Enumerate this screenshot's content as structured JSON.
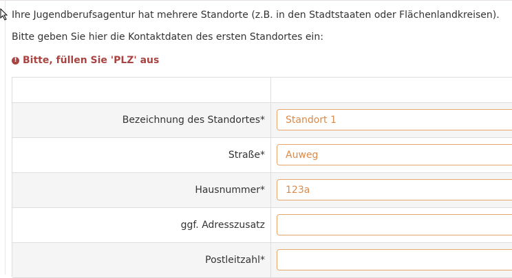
{
  "intro": {
    "line1": "Ihre Jugendberufsagentur hat mehrere Standorte (z.B. in den Stadtstaaten oder Flächenlandkreisen).",
    "line2": "Bitte geben Sie hier die Kontaktdaten des ersten Standortes ein:"
  },
  "error": {
    "message": "Bitte, füllen Sie 'PLZ' aus"
  },
  "form": {
    "fields": [
      {
        "label": "Bezeichnung des Standortes*",
        "value": "Standort 1"
      },
      {
        "label": "Straße*",
        "value": "Auweg"
      },
      {
        "label": "Hausnummer*",
        "value": "123a"
      },
      {
        "label": "ggf. Adresszusatz",
        "value": ""
      },
      {
        "label": "Postleitzahl*",
        "value": ""
      }
    ]
  },
  "colors": {
    "error": "#a94442",
    "field_border": "#e8a76a",
    "field_text": "#d98a4a"
  }
}
